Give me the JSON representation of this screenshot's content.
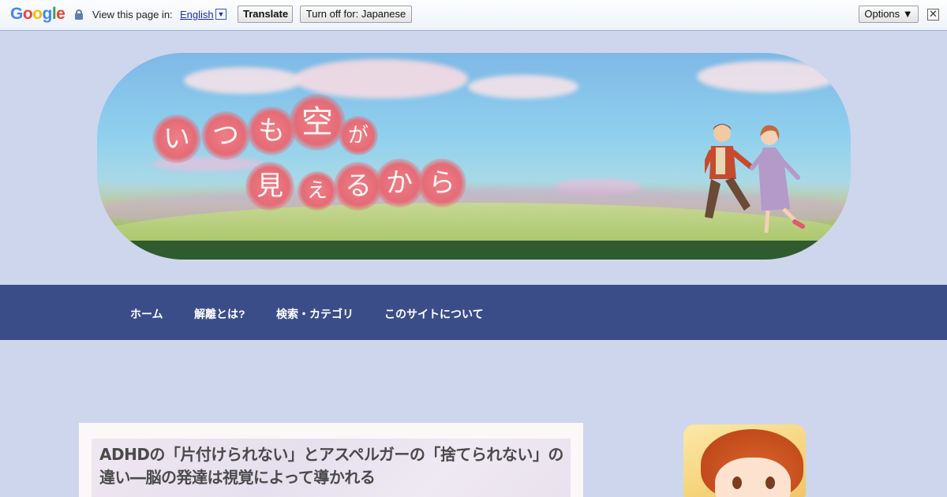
{
  "translate_bar": {
    "logo": "Google",
    "view_label": "View this page in:",
    "language": "English",
    "dropdown_glyph": "▼",
    "translate_button": "Translate",
    "turn_off_button": "Turn off for: Japanese",
    "options_button": "Options ▼",
    "close_glyph": "✕",
    "icons": [
      "lock-icon",
      "close-icon"
    ]
  },
  "header": {
    "title_line1": [
      "い",
      "つ",
      "も",
      "空",
      "が"
    ],
    "title_line2": [
      "見",
      "え",
      "る",
      "か",
      "ら"
    ]
  },
  "nav": {
    "items": [
      "ホーム",
      "解離とは?",
      "検索・カテゴリ",
      "このサイトについて"
    ]
  },
  "article": {
    "title": "ADHDの「片付けられない」とアスペルガーの「捨てられない」の違い―脳の発達は視覚によって導かれる"
  },
  "colors": {
    "background": "#cdd6ec",
    "nav_bar": "#3b4d89",
    "title_bubble": "#e56b76"
  }
}
